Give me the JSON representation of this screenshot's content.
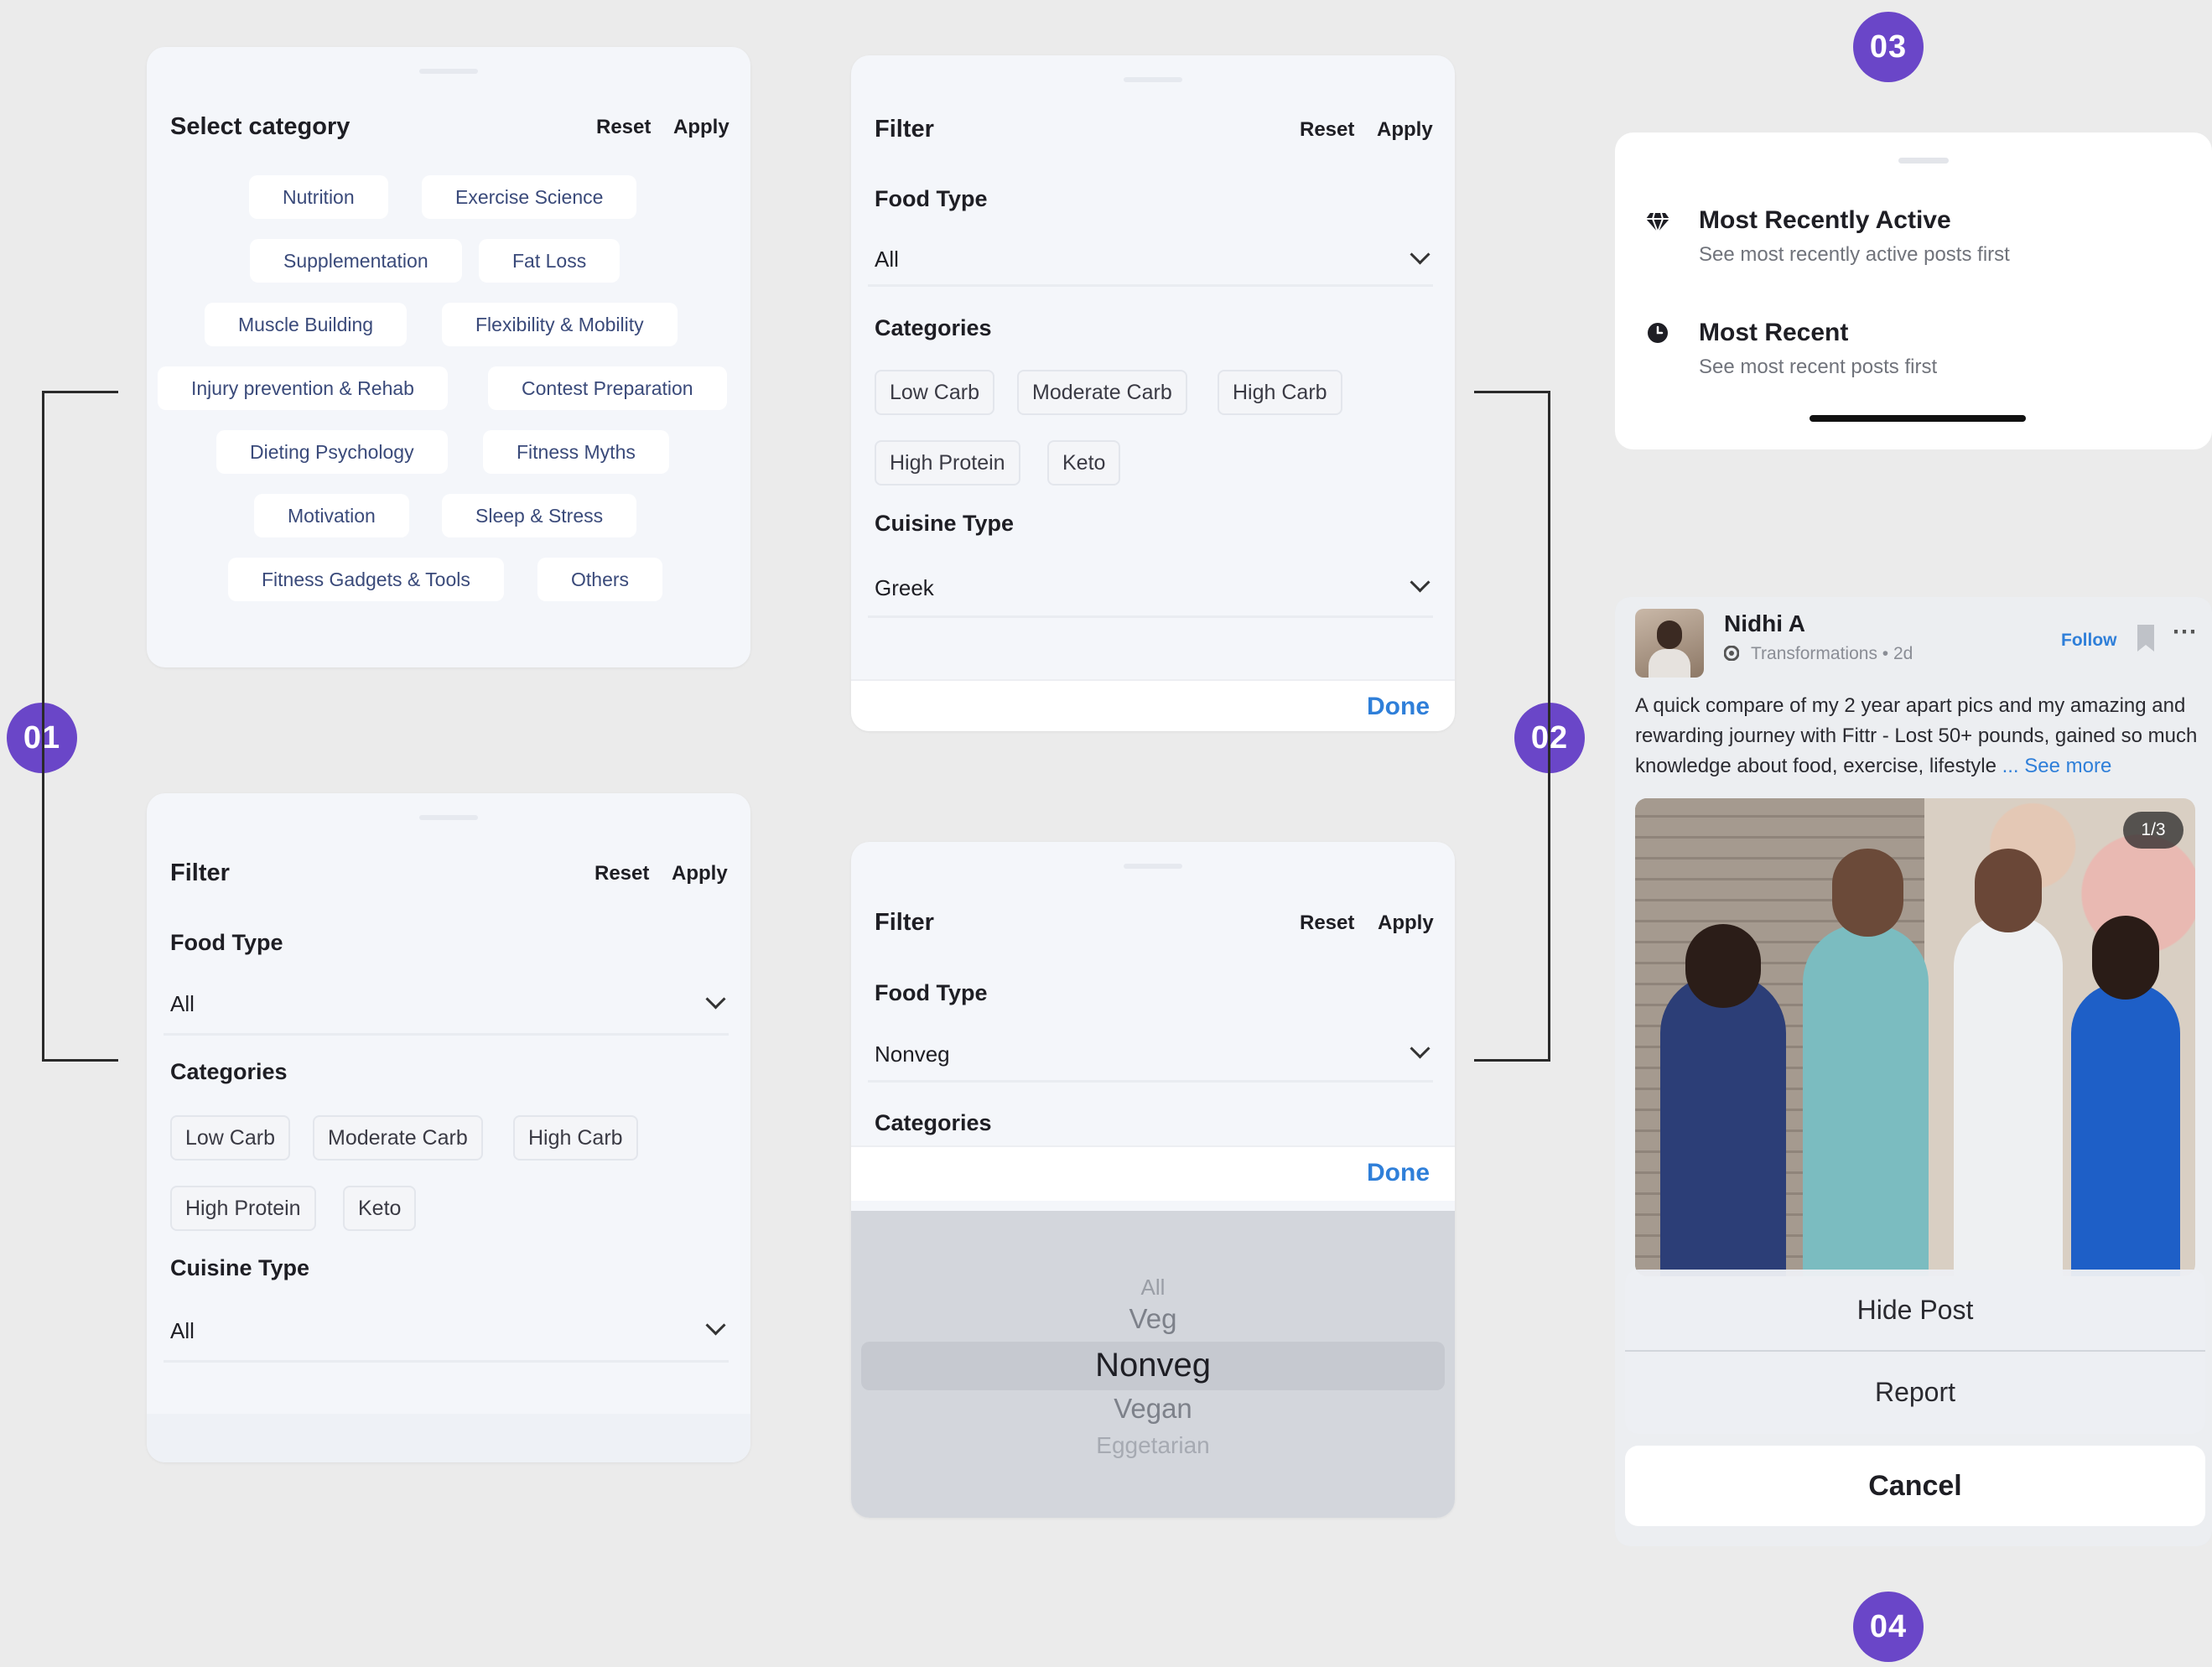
{
  "badges": {
    "b1": "01",
    "b2": "02",
    "b3": "03",
    "b4": "04"
  },
  "select_category": {
    "title": "Select category",
    "reset": "Reset",
    "apply": "Apply",
    "chips": [
      "Nutrition",
      "Exercise Science",
      "Supplementation",
      "Fat Loss",
      "Muscle Building",
      "Flexibility & Mobility",
      "Injury prevention & Rehab",
      "Contest Preparation",
      "Dieting Psychology",
      "Fitness Myths",
      "Motivation",
      "Sleep & Stress",
      "Fitness Gadgets & Tools",
      "Others"
    ]
  },
  "filter_a": {
    "title": "Filter",
    "reset": "Reset",
    "apply": "Apply",
    "food_type_label": "Food Type",
    "food_type_value": "All",
    "categories_label": "Categories",
    "categories": [
      "Low Carb",
      "Moderate Carb",
      "High Carb",
      "High Protein",
      "Keto"
    ],
    "cuisine_label": "Cuisine Type",
    "cuisine_value": "All"
  },
  "filter_b": {
    "title": "Filter",
    "reset": "Reset",
    "apply": "Apply",
    "food_type_label": "Food Type",
    "food_type_value": "All",
    "categories_label": "Categories",
    "categories": [
      "Low Carb",
      "Moderate Carb",
      "High Carb",
      "High Protein",
      "Keto"
    ],
    "cuisine_label": "Cuisine Type",
    "cuisine_value": "Greek",
    "done": "Done"
  },
  "filter_c": {
    "title": "Filter",
    "reset": "Reset",
    "apply": "Apply",
    "food_type_label": "Food Type",
    "food_type_value": "Nonveg",
    "categories_label": "Categories",
    "done": "Done",
    "picker": [
      "All",
      "Veg",
      "Nonveg",
      "Vegan",
      "Eggetarian"
    ],
    "picker_selected": "Nonveg"
  },
  "sort_sheet": {
    "options": [
      {
        "title": "Most Recently Active",
        "subtitle": "See most recently active posts first",
        "icon": "diamond-icon"
      },
      {
        "title": "Most Recent",
        "subtitle": "See most recent posts first",
        "icon": "clock-icon"
      }
    ]
  },
  "post": {
    "author": "Nidhi A",
    "meta": "Transformations • 2d",
    "follow": "Follow",
    "text": "A quick compare of my 2 year apart pics and my amazing and rewarding journey with Fittr - Lost 50+ pounds, gained so much knowledge about food, exercise, lifestyle",
    "see_more": "... See more",
    "counter": "1/3",
    "actions": [
      "Hide Post",
      "Report"
    ],
    "cancel": "Cancel"
  },
  "colors": {
    "accent": "#6a46c8",
    "link": "#2f7fd9",
    "chip_text": "#3a4a7a"
  }
}
